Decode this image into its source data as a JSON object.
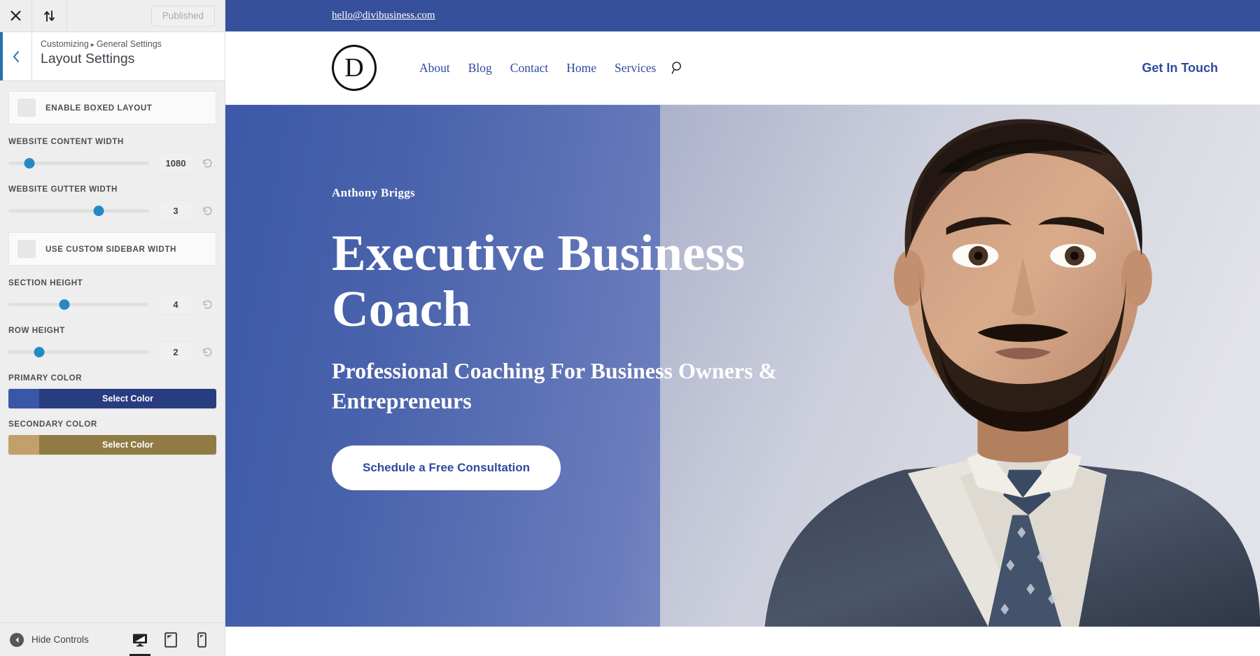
{
  "customizer": {
    "topbar": {
      "close_icon": "close-icon",
      "devices_icon": "collapse-arrows-icon",
      "published_label": "Published"
    },
    "header": {
      "back_icon": "chevron-left-icon",
      "breadcrumb_root": "Customizing",
      "breadcrumb_separator": "▸",
      "breadcrumb_section": "General Settings",
      "panel_title": "Layout Settings"
    },
    "controls": [
      {
        "type": "toggle",
        "label": "ENABLE BOXED LAYOUT",
        "checked": false
      },
      {
        "type": "slider",
        "label": "WEBSITE CONTENT WIDTH",
        "value": "1080",
        "percent": 15
      },
      {
        "type": "slider",
        "label": "WEBSITE GUTTER WIDTH",
        "value": "3",
        "percent": 64
      },
      {
        "type": "toggle",
        "label": "USE CUSTOM SIDEBAR WIDTH",
        "checked": false
      },
      {
        "type": "slider",
        "label": "SECTION HEIGHT",
        "value": "4",
        "percent": 40
      },
      {
        "type": "slider",
        "label": "ROW HEIGHT",
        "value": "2",
        "percent": 22
      },
      {
        "type": "color",
        "label": "PRIMARY COLOR",
        "button_label": "Select Color",
        "swatch": "#3a56a8",
        "fill": "#283d80"
      },
      {
        "type": "color",
        "label": "SECONDARY COLOR",
        "button_label": "Select Color",
        "swatch": "#c2a06a",
        "fill": "#907b44"
      }
    ],
    "footer": {
      "hide_controls_label": "Hide Controls",
      "hide_controls_icon": "caret-left-circle-icon",
      "devices": [
        {
          "name": "desktop",
          "icon": "desktop-icon",
          "active": true
        },
        {
          "name": "tablet",
          "icon": "tablet-icon",
          "active": false
        },
        {
          "name": "mobile",
          "icon": "mobile-icon",
          "active": false
        }
      ]
    }
  },
  "site": {
    "topbar": {
      "email": "hello@divibusiness.com",
      "background": "#37509b"
    },
    "nav": {
      "logo_letter": "D",
      "links": [
        "About",
        "Blog",
        "Contact",
        "Home",
        "Services"
      ],
      "search_icon": "search-icon",
      "cta_label": "Get In Touch",
      "link_color": "#2d4a9e"
    },
    "hero": {
      "eyebrow": "Anthony Briggs",
      "title": "Executive Business Coach",
      "subtitle": "Professional Coaching For Business Owners & Entrepreneurs",
      "cta_label": "Schedule a Free Consultation",
      "gradient_start": "#3c58a8",
      "gradient_end": "#d8dae3"
    }
  }
}
